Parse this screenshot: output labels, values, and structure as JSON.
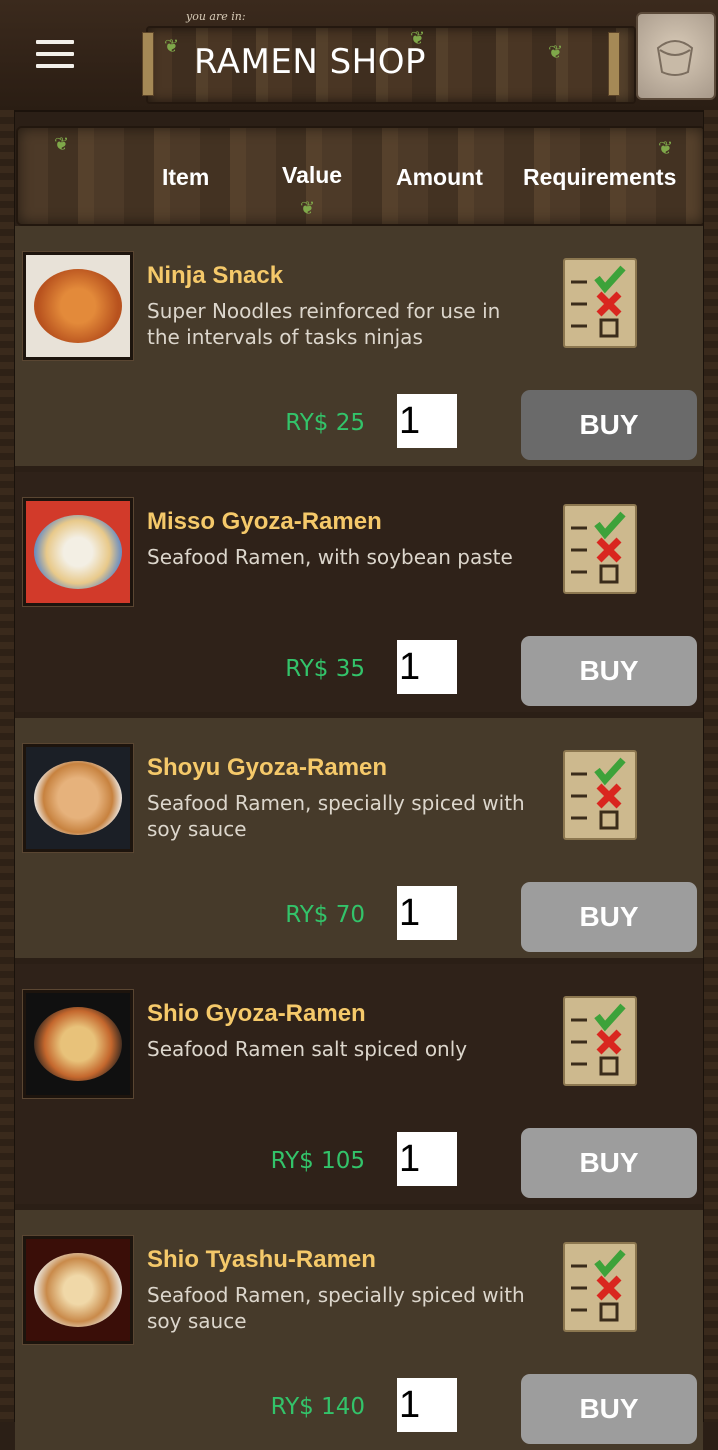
{
  "header": {
    "location_prefix": "you are in:",
    "title": "RAMEN SHOP"
  },
  "columns": {
    "item": "Item",
    "value": "Value",
    "amount": "Amount",
    "requirements": "Requirements"
  },
  "colors": {
    "name": "#f5c96a",
    "price": "#33c36a",
    "buy_button": "#9d9d9d",
    "buy_button_active": "#6a6a6a",
    "row_light": "#463a2a",
    "row_dark": "#2f2219"
  },
  "items": [
    {
      "name": "Ninja Snack",
      "description": "Super Noodles reinforced for use in the intervals of tasks ninjas",
      "price": "RY$ 25",
      "quantity": "1",
      "buy_label": "BUY",
      "image_icon": "noodles-icon",
      "requirements_icon": "checklist-icon"
    },
    {
      "name": "Misso Gyoza-Ramen",
      "description": "Seafood Ramen, with soybean paste",
      "price": "RY$ 35",
      "quantity": "1",
      "buy_label": "BUY",
      "image_icon": "ramen-bowl-icon",
      "requirements_icon": "checklist-icon"
    },
    {
      "name": "Shoyu Gyoza-Ramen",
      "description": "Seafood Ramen, specially spiced with soy sauce",
      "price": "RY$ 70",
      "quantity": "1",
      "buy_label": "BUY",
      "image_icon": "ramen-bowl-icon",
      "requirements_icon": "checklist-icon"
    },
    {
      "name": "Shio Gyoza-Ramen",
      "description": "Seafood Ramen salt spiced only",
      "price": "RY$ 105",
      "quantity": "1",
      "buy_label": "BUY",
      "image_icon": "ramen-bowl-icon",
      "requirements_icon": "checklist-icon"
    },
    {
      "name": "Shio Tyashu-Ramen",
      "description": "Seafood Ramen, specially spiced with soy sauce",
      "price": "RY$ 140",
      "quantity": "1",
      "buy_label": "BUY",
      "image_icon": "ramen-bowl-icon",
      "requirements_icon": "checklist-icon"
    }
  ]
}
